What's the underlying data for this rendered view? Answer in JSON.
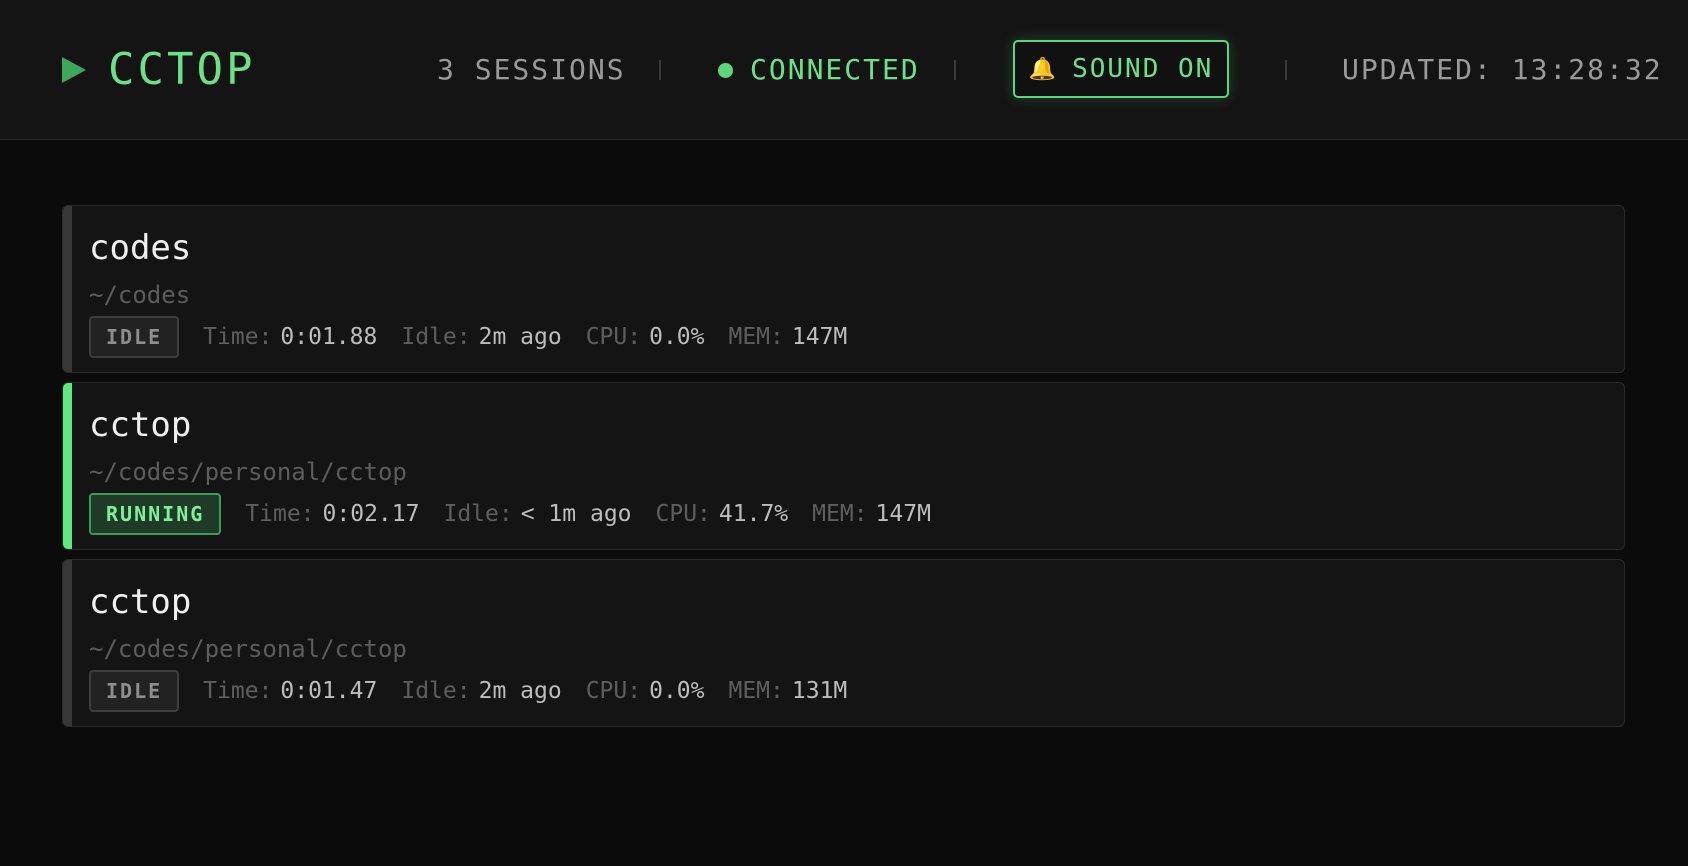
{
  "header": {
    "title": "CCTOP",
    "sessions": "3 SESSIONS",
    "status": "CONNECTED",
    "sound_label": "SOUND ON",
    "updated": "UPDATED: 13:28:32"
  },
  "labels": {
    "time": "Time:",
    "idle": "Idle:",
    "cpu": "CPU:",
    "mem": "MEM:"
  },
  "sessions": [
    {
      "name": "codes",
      "path": "~/codes",
      "status": "IDLE",
      "time": "0:01.88",
      "idle": "2m ago",
      "cpu": "0.0%",
      "mem": "147M"
    },
    {
      "name": "cctop",
      "path": "~/codes/personal/cctop",
      "status": "RUNNING",
      "time": "0:02.17",
      "idle": "< 1m ago",
      "cpu": "41.7%",
      "mem": "147M"
    },
    {
      "name": "cctop",
      "path": "~/codes/personal/cctop",
      "status": "IDLE",
      "time": "0:01.47",
      "idle": "2m ago",
      "cpu": "0.0%",
      "mem": "131M"
    }
  ],
  "colors": {
    "accent": "#6ee08a",
    "running": "#5ee87f",
    "background": "#0b0b0b"
  }
}
